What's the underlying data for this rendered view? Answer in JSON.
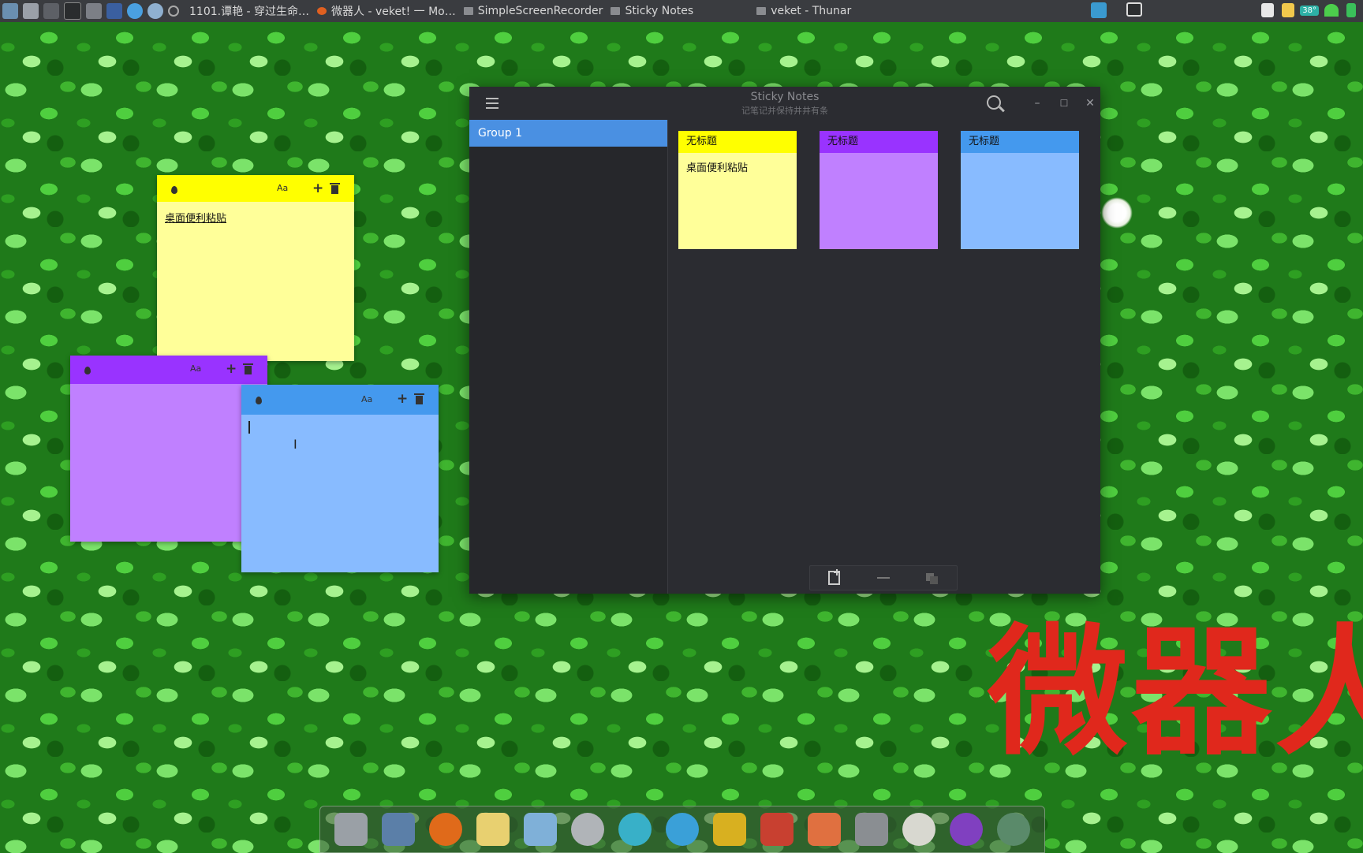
{
  "taskbar": {
    "tasks": [
      {
        "label": "1101.谭艳 - 穿过生命…"
      },
      {
        "label": "微器人 - veket! 一 Mo…"
      },
      {
        "label": "SimpleScreenRecorder"
      },
      {
        "label": "Sticky Notes"
      },
      {
        "label": "veket - Thunar"
      }
    ],
    "temperature": "38°"
  },
  "desktop_notes": [
    {
      "color": "#ffff00",
      "body_color": "#ffff99",
      "text": "桌面便利粘贴"
    },
    {
      "color": "#9933ff",
      "body_color": "#c080ff",
      "text": ""
    },
    {
      "color": "#4499ee",
      "body_color": "#88bbff",
      "text": ""
    }
  ],
  "window": {
    "title": "Sticky Notes",
    "subtitle": "记笔记并保持井井有条",
    "group": {
      "label": "Group 1"
    },
    "notes": [
      {
        "title": "无标题",
        "text": "桌面便利粘贴",
        "head_color": "#ffff00",
        "body_color": "#ffff99"
      },
      {
        "title": "无标题",
        "text": "",
        "head_color": "#9933ff",
        "body_color": "#c080ff"
      },
      {
        "title": "无标题",
        "text": "",
        "head_color": "#4499ee",
        "body_color": "#88bbff"
      }
    ]
  },
  "wallpaper_text": "微器人",
  "icons": [
    "hamburger-icon",
    "search-icon",
    "minimize-icon",
    "maximize-icon",
    "close-icon",
    "drop-icon",
    "font-icon",
    "plus-icon",
    "trash-icon",
    "new-note-icon",
    "minus-icon",
    "duplicate-icon"
  ]
}
